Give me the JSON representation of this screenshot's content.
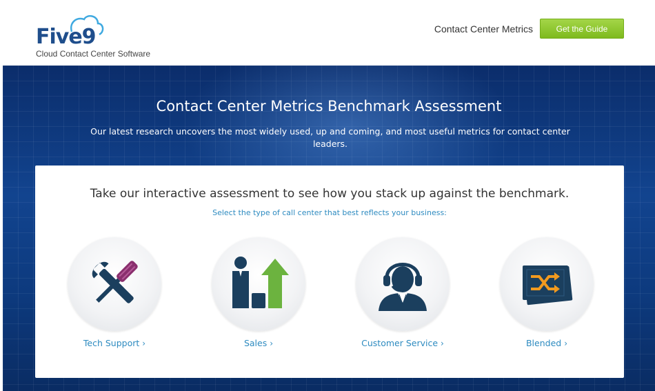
{
  "header": {
    "logo_text": "Five9",
    "tagline": "Cloud Contact Center Software",
    "nav_link": "Contact Center Metrics",
    "cta_label": "Get the Guide"
  },
  "hero": {
    "title": "Contact Center Metrics Benchmark Assessment",
    "subtitle": "Our latest research uncovers the most widely used, up and coming, and most useful metrics for contact center leaders."
  },
  "card": {
    "title": "Take our interactive assessment to see how you stack up against the benchmark.",
    "subtitle": "Select the type of call center that best reflects your business:",
    "options": [
      {
        "label": "Tech Support",
        "icon": "wrench-screwdriver-icon"
      },
      {
        "label": "Sales",
        "icon": "sales-growth-icon"
      },
      {
        "label": "Customer Service",
        "icon": "headset-agent-icon"
      },
      {
        "label": "Blended",
        "icon": "shuffle-icon"
      }
    ],
    "chevron": "›"
  },
  "colors": {
    "brand_blue": "#1f4e8c",
    "link_blue": "#2e8bc0",
    "cta_green": "#8dc63f",
    "icon_navy": "#1b3f5e",
    "icon_purple": "#8a2f6e",
    "icon_green": "#6cb33f",
    "icon_orange": "#f29a1f"
  }
}
